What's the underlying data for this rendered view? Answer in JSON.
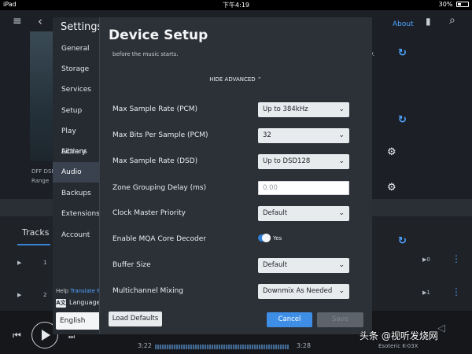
{
  "status_bar": {
    "device": "iPad",
    "time": "下午4:19",
    "battery": "30%"
  },
  "background": {
    "about_link": "About",
    "dff_text": "DFF DSD",
    "range_text": "Range",
    "tracks_tab": "Tracks",
    "rows": [
      {
        "number": "1",
        "stat": "0"
      },
      {
        "number": "2",
        "stat": "1"
      }
    ],
    "time_elapsed": "3:22",
    "time_total": "3:28",
    "device_name": "Esoteric K-03X"
  },
  "settings": {
    "title": "Settings",
    "nav": [
      {
        "label": "General"
      },
      {
        "label": "Storage"
      },
      {
        "label": "Services"
      },
      {
        "label": "Setup"
      },
      {
        "label": "Play Actions"
      },
      {
        "label": "Library"
      },
      {
        "label": "Audio"
      },
      {
        "label": "Backups"
      },
      {
        "label": "Extensions"
      },
      {
        "label": "Account"
      }
    ],
    "help_label": "Help",
    "translate_label": "Translate R",
    "language_label": "Language",
    "language_value": "English"
  },
  "device_setup": {
    "title": "Device Setup",
    "subtitle": "before the music starts.",
    "hide_advanced": "HIDE ADVANCED",
    "max_sample_rate_pcm": {
      "label": "Max Sample Rate (PCM)",
      "value": "Up to 384kHz"
    },
    "max_bits_pcm": {
      "label": "Max Bits Per Sample (PCM)",
      "value": "32"
    },
    "max_sample_rate_dsd": {
      "label": "Max Sample Rate (DSD)",
      "value": "Up to DSD128"
    },
    "zone_grouping_delay": {
      "label": "Zone Grouping Delay (ms)",
      "placeholder": "0.00"
    },
    "clock_master": {
      "label": "Clock Master Priority",
      "value": "Default"
    },
    "mqa_decoder": {
      "label": "Enable MQA Core Decoder",
      "value": "Yes",
      "enabled": true
    },
    "buffer_size": {
      "label": "Buffer Size",
      "value": "Default"
    },
    "multichannel": {
      "label": "Multichannel Mixing",
      "value": "Downmix As Needed"
    },
    "buttons": {
      "load_defaults": "Load Defaults",
      "cancel": "Cancel",
      "save": "Save"
    }
  },
  "watermark": "头条 @视听发烧网",
  "colors": {
    "accent": "#3f8ee6",
    "link": "#4ea3ff",
    "modal_bg": "#2c3137",
    "active_nav": "#3a4250"
  }
}
